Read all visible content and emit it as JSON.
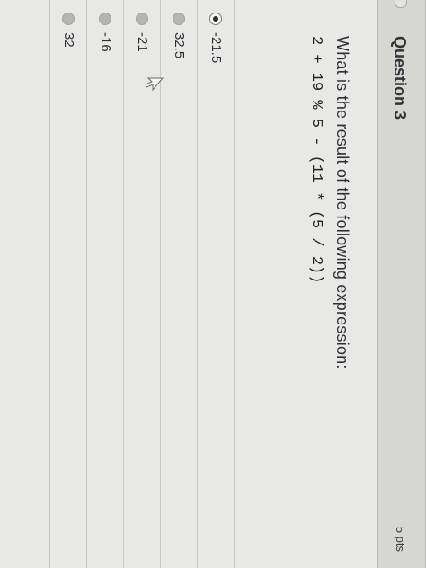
{
  "question": {
    "title": "Question 3",
    "points": "5 pts",
    "prompt": "What is the result of the following expression:",
    "expression": "2 + 19 % 5 - (11 * (5 / 2))"
  },
  "answers": [
    {
      "label": "-21.5",
      "selected": true
    },
    {
      "label": "32.5",
      "selected": false
    },
    {
      "label": "-21",
      "selected": false
    },
    {
      "label": "-16",
      "selected": false
    },
    {
      "label": "32",
      "selected": false
    }
  ],
  "colors": {
    "page_bg": "#e8e8e6",
    "header_bg": "#d6d6d3",
    "text": "#2d3033",
    "radio_unselected": "#b5b5b2"
  },
  "icons": {
    "cursor": "mouse-pointer-icon",
    "radio_selected": "radio-selected-icon",
    "radio_unselected": "radio-unselected-icon"
  }
}
